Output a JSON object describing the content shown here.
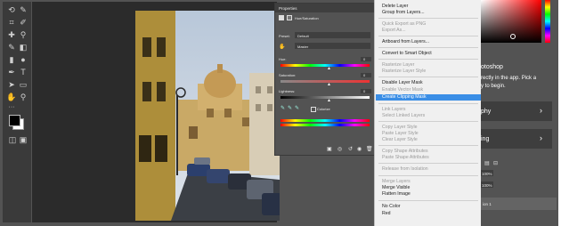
{
  "properties": {
    "tab": "Properties",
    "panel_title": "Hue/Saturation",
    "preset_label": "Preset:",
    "preset_value": "Default",
    "channel": "Master",
    "hue_label": "Hue:",
    "hue_value": "0",
    "saturation_label": "Saturation:",
    "saturation_value": "0",
    "lightness_label": "Lightness:",
    "lightness_value": "0",
    "colorize_label": "Colorize"
  },
  "context_menu": {
    "items": [
      {
        "label": "Delete Layer",
        "enabled": true
      },
      {
        "label": "Group from Layers...",
        "enabled": true
      },
      {
        "label": "Quick Export as PNG",
        "enabled": false
      },
      {
        "label": "Export As...",
        "enabled": false
      },
      {
        "label": "Artboard from Layers...",
        "enabled": true
      },
      {
        "label": "Convert to Smart Object",
        "enabled": true
      },
      {
        "label": "Rasterize Layer",
        "enabled": false
      },
      {
        "label": "Rasterize Layer Style",
        "enabled": false
      },
      {
        "label": "Disable Layer Mask",
        "enabled": true
      },
      {
        "label": "Enable Vector Mask",
        "enabled": false
      },
      {
        "label": "Create Clipping Mask",
        "enabled": true,
        "highlighted": true
      },
      {
        "label": "Link Layers",
        "enabled": false
      },
      {
        "label": "Select Linked Layers",
        "enabled": false
      },
      {
        "label": "Copy Layer Style",
        "enabled": false
      },
      {
        "label": "Paste Layer Style",
        "enabled": false
      },
      {
        "label": "Clear Layer Style",
        "enabled": false
      },
      {
        "label": "Copy Shape Attributes",
        "enabled": false
      },
      {
        "label": "Paste Shape Attributes",
        "enabled": false
      },
      {
        "label": "Release from Isolation",
        "enabled": false
      },
      {
        "label": "Merge Layers",
        "enabled": false
      },
      {
        "label": "Merge Visible",
        "enabled": true
      },
      {
        "label": "Flatten Image",
        "enabled": true
      },
      {
        "label": "No Color",
        "enabled": true
      },
      {
        "label": "Red",
        "enabled": true
      }
    ]
  },
  "right_panel": {
    "promo_line1": "otoshop",
    "promo_line2": "rectly in the app. Pick a",
    "promo_line3": "y to begin.",
    "card1": "phy",
    "card2": "ing",
    "opacity": "100%",
    "fill": "100%",
    "layer_name": "ion 1"
  },
  "colors": {
    "accent": "#3a8ee6",
    "app_bg": "#535353",
    "toolbar_bg": "#3a3a3a"
  }
}
